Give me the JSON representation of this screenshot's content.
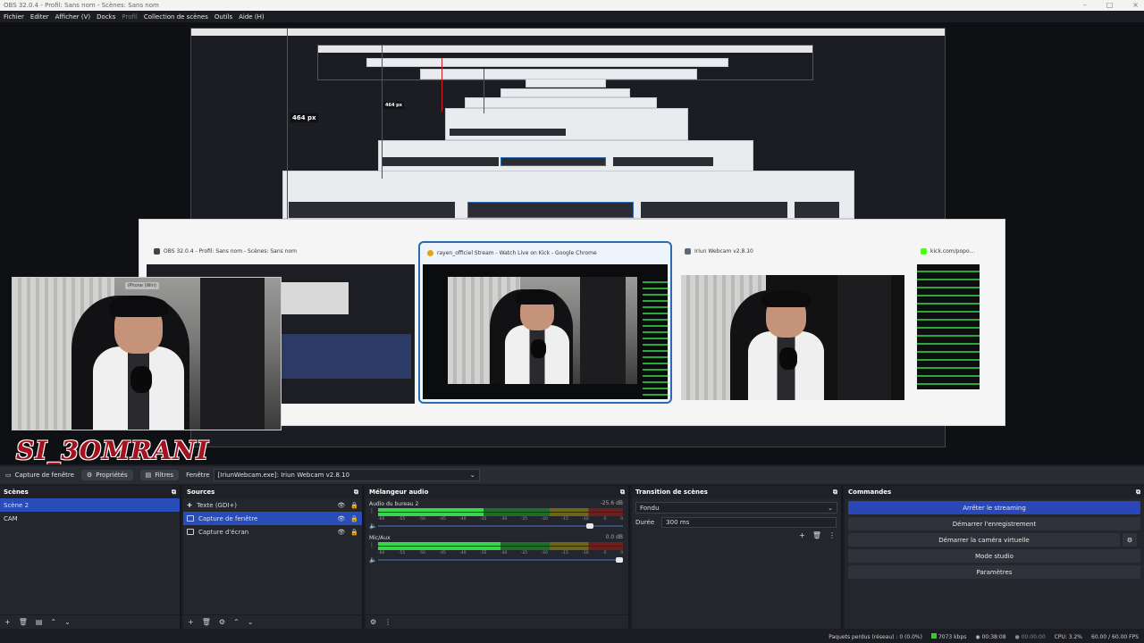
{
  "window": {
    "title": "OBS 32.0.4 - Profil: Sans nom - Scènes: Sans nom"
  },
  "menu": [
    {
      "label": "Fichier",
      "enabled": true
    },
    {
      "label": "Editer",
      "enabled": true
    },
    {
      "label": "Afficher (V)",
      "enabled": true
    },
    {
      "label": "Docks",
      "enabled": true
    },
    {
      "label": "Profil",
      "enabled": false
    },
    {
      "label": "Collection de scènes",
      "enabled": true
    },
    {
      "label": "Outils",
      "enabled": true
    },
    {
      "label": "Aide (H)",
      "enabled": true
    }
  ],
  "preview": {
    "dimension_label_1": "464 px",
    "dimension_label_2": "464 px",
    "overlay_text": "SI_3OMRANI",
    "cam_tag": "iPhone (Wiri)"
  },
  "switcher": {
    "tiles": [
      {
        "title": "OBS 32.0.4 - Profil: Sans nom - Scènes: Sans nom",
        "color": "#444"
      },
      {
        "title": "rayen_officiel Stream - Watch Live on Kick - Google Chrome",
        "color": "#e3a31c"
      },
      {
        "title": "Iriun Webcam v2.8.10",
        "color": "#5c6b7a"
      },
      {
        "title": "kick.com/popo...",
        "color": "#53fc18"
      }
    ]
  },
  "source_toolbar": {
    "source_name": "Capture de fenêtre",
    "properties": "Propriétés",
    "filters": "Filtres",
    "window_label": "Fenêtre",
    "window_value": "[IriunWebcam.exe]: Iriun Webcam v2.8.10"
  },
  "scenes": {
    "title": "Scènes",
    "items": [
      "Scène 2",
      "CAM"
    ],
    "selected_index": 0
  },
  "sources": {
    "title": "Sources",
    "items": [
      {
        "label": "Texte (GDI+)",
        "icon": "text-icon"
      },
      {
        "label": "Capture de fenêtre",
        "icon": "window-icon",
        "selected": true
      },
      {
        "label": "Capture d'écran",
        "icon": "monitor-icon"
      }
    ]
  },
  "mixer": {
    "title": "Mélangeur audio",
    "channels": [
      {
        "name": "Audio du bureau 2",
        "db": "-25.6 dB",
        "level_percent": 43,
        "fader_percent": 88
      },
      {
        "name": "Mic/Aux",
        "db": "0.0 dB",
        "level_percent": 50,
        "fader_percent": 100
      }
    ],
    "scale": [
      "-60",
      "-55",
      "-50",
      "-45",
      "-40",
      "-35",
      "-30",
      "-25",
      "-20",
      "-15",
      "-10",
      "-5",
      "0"
    ]
  },
  "transitions": {
    "title": "Transition de scènes",
    "selected": "Fondu",
    "duration_label": "Durée",
    "duration_value": "300 ms"
  },
  "controls": {
    "title": "Commandes",
    "buttons": [
      "Arrêter le streaming",
      "Démarrer l'enregistrement",
      "Démarrer la caméra virtuelle",
      "Mode studio",
      "Paramètres"
    ]
  },
  "status": {
    "dropped": "Paquets perdus (réseau) : 0 (0.0%)",
    "bitrate": "7073 kbps",
    "stream_time": "00:38:08",
    "rec_time": "00:00:00",
    "cpu": "CPU: 3.2%",
    "fps": "60.00 / 60.00 FPS"
  },
  "colors": {
    "accent": "#284cb8",
    "selected_border": "#2b6cb0",
    "overlay_red": "#a3121e",
    "live_green": "#3ac73a"
  }
}
